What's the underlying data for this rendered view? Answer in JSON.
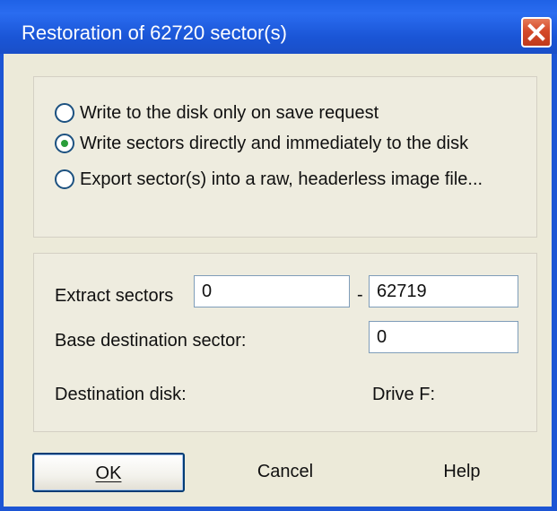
{
  "dialog": {
    "title": "Restoration of 62720 sector(s)",
    "close_icon": "close-icon"
  },
  "mode": {
    "options": [
      {
        "label": "Write to the disk only on save request",
        "checked": false
      },
      {
        "label": "Write sectors directly and immediately to the disk",
        "checked": true
      },
      {
        "label": "Export sector(s) into a raw, headerless image file...",
        "checked": false
      }
    ]
  },
  "sectors": {
    "extract_label": "Extract sectors",
    "extract_from": "0",
    "separator": "-",
    "extract_to": "62719",
    "base_label": "Base destination sector:",
    "base_value": "0",
    "dest_label": "Destination disk:",
    "dest_value": "Drive F:"
  },
  "buttons": {
    "ok": "OK",
    "cancel": "Cancel",
    "help": "Help"
  },
  "colors": {
    "titlebar": "#1f62e6",
    "close": "#d54a29",
    "radio_dot": "#2a9d3a"
  }
}
